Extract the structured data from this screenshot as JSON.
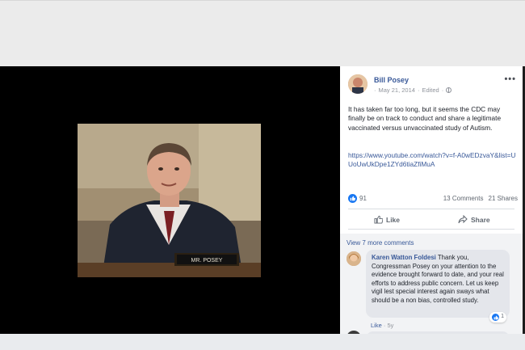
{
  "post": {
    "author": "Bill Posey",
    "date": "May 21, 2014",
    "edited": "Edited",
    "text": "It has taken far too long, but it seems the CDC may finally be on track to conduct and share a legitimate vaccinated versus unvaccinated study of Autism.",
    "link": "https://www.youtube.com/watch?v=f-A0wEDzvaY&list=UUoUwUkDpe1ZYd6tiaZfiMuA",
    "likes": "91",
    "comments_count": "13 Comments",
    "shares_count": "21 Shares",
    "actions": {
      "like": "Like",
      "share": "Share"
    }
  },
  "video": {
    "nameplate": "MR. POSEY"
  },
  "comments": {
    "view_more": "View 7 more comments",
    "items": [
      {
        "name": "Karen Watton Foldesi",
        "text": "Thank you, Congressman Posey on your attention to the evidence brought forward to date, and your real efforts to address public concern. Let us keep vigil lest special interest again sways what should be a non bias, controlled study.",
        "reactions": "1",
        "like_label": "Like",
        "time": "5y"
      }
    ]
  },
  "colors": {
    "link": "#385898",
    "like_blue": "#1877f2",
    "media_bg": "#000000"
  }
}
